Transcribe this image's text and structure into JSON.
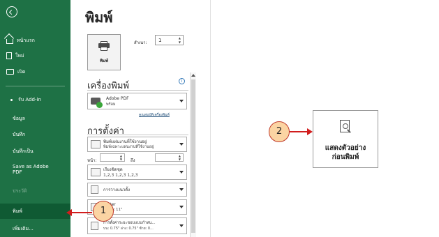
{
  "sidebar": {
    "items": [
      {
        "label": "หน้าแรก"
      },
      {
        "label": "ใหม่"
      },
      {
        "label": "เปิด"
      },
      {
        "label": "รับ Add-in"
      },
      {
        "label": "ข้อมูล"
      },
      {
        "label": "บันทึก"
      },
      {
        "label": "บันทึกเป็น"
      },
      {
        "label": "Save as Adobe PDF"
      },
      {
        "label": "ประวัติ"
      },
      {
        "label": "พิมพ์"
      },
      {
        "label": "เพิ่มเติม..."
      }
    ]
  },
  "header": {
    "title": "พิมพ์"
  },
  "print": {
    "button_label": "พิมพ์",
    "copies_label": "สำเนา:",
    "copies_value": "1"
  },
  "printer": {
    "section_title": "เครื่องพิมพ์",
    "info_glyph": "i",
    "name": "Adobe PDF",
    "status": "พร้อม",
    "properties_link": "คุณสมบัติเครื่องพิมพ์"
  },
  "settings": {
    "section_title": "การตั้งค่า",
    "active_sheets_line1": "พิมพ์แผ่นงานที่ใช้งานอยู่",
    "active_sheets_line2": "พิมพ์เฉพาะแผ่นงานที่ใช้งานอยู่",
    "pages_label": "หน้า:",
    "to_label": "ถึง",
    "collated_line1": "เรียงชิดชุด",
    "collated_line2": "1,2,3   1,2,3   1,2,3",
    "orientation": "การวางแนวตั้ง",
    "paper_line1": "Letter",
    "paper_line2": "8.5\" x 11\"",
    "margins_line1": "การตั้งค่าระยะขอบแบบกำหน...",
    "margins_line2": "บน: 0.75\" ล่าง: 0.75\" ซ้าย: 0..."
  },
  "preview": {
    "label_line1": "แสดงตัวอย่าง",
    "label_line2": "ก่อนพิมพ์"
  },
  "callouts": {
    "one": "1",
    "two": "2"
  },
  "colors": {
    "sidebar": "#1e7145",
    "sidebar_active": "#0f5a33",
    "arrow": "#d11d1d",
    "callout_fill": "#fbd4a3"
  }
}
